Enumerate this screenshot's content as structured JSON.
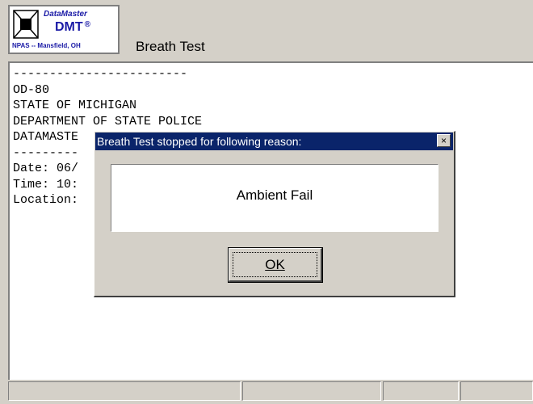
{
  "header": {
    "logo": {
      "brand": "DataMaster",
      "model": "DMT",
      "registered": "®",
      "location": "NPAS -- Mansfield, OH"
    },
    "title": "Breath Test"
  },
  "document": {
    "lines": [
      "------------------------",
      "OD-80",
      "STATE OF MICHIGAN",
      "DEPARTMENT OF STATE POLICE",
      "DATAMASTE",
      "---------",
      "Date: 06/",
      "Time: 10:",
      "Location:"
    ]
  },
  "dialog": {
    "title": "Breath Test stopped for following reason:",
    "close_label": "×",
    "message": "Ambient Fail",
    "ok_label": "OK"
  },
  "statusbar": {
    "cells": [
      "",
      "",
      "",
      ""
    ]
  },
  "colors": {
    "titlebar": "#0a246a",
    "window_bg": "#d4d0c8",
    "brand_blue": "#1a1aa6"
  }
}
